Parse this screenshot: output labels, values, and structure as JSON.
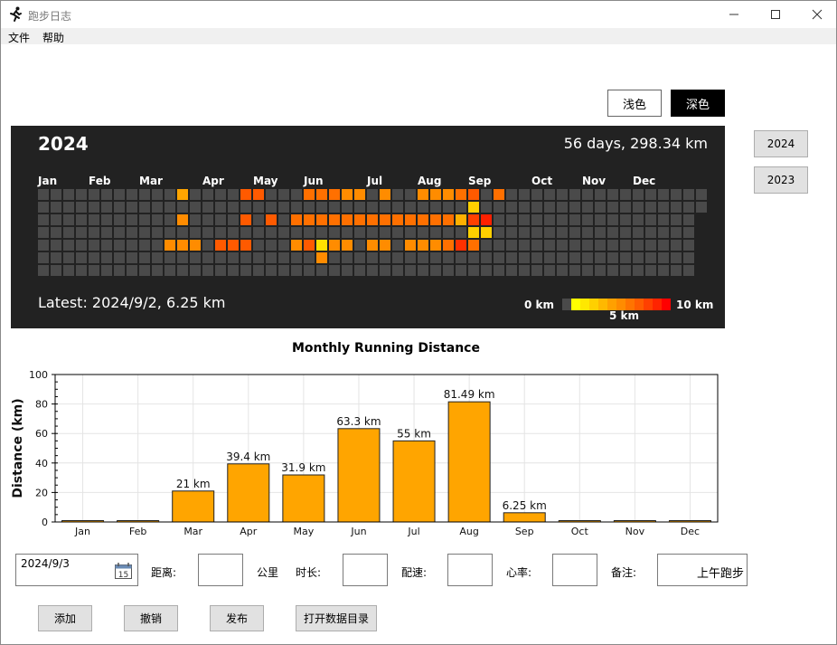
{
  "window": {
    "title": "跑步日志"
  },
  "menu": {
    "file": "文件",
    "help": "帮助"
  },
  "theme": {
    "light": "浅色",
    "dark": "深色"
  },
  "year_buttons": [
    "2024",
    "2023"
  ],
  "heatmap": {
    "year": "2024",
    "summary": "56 days, 298.34 km",
    "latest": "Latest:  2024/9/2, 6.25 km",
    "months": [
      "Jan",
      "Feb",
      "Mar",
      "Apr",
      "May",
      "Jun",
      "Jul",
      "Aug",
      "Sep",
      "Oct",
      "Nov",
      "Dec"
    ],
    "empty_color": "#4a4a4a",
    "legend": {
      "min_label": "0 km",
      "mid_label": "5 km",
      "max_label": "10 km",
      "colors": [
        "#4a4a4a",
        "#ffff00",
        "#ffe800",
        "#ffd000",
        "#ffb800",
        "#ffa000",
        "#ff8c00",
        "#ff7400",
        "#ff5c00",
        "#ff4000",
        "#ff2400",
        "#ff0000"
      ]
    },
    "active_cells": [
      {
        "w": 11,
        "d": 0,
        "color": "#ffa500"
      },
      {
        "w": 11,
        "d": 2,
        "color": "#ff8c00"
      },
      {
        "w": 10,
        "d": 4,
        "color": "#ff8c00"
      },
      {
        "w": 11,
        "d": 4,
        "color": "#ff8c00"
      },
      {
        "w": 12,
        "d": 4,
        "color": "#ff8c00"
      },
      {
        "w": 16,
        "d": 0,
        "color": "#ff5a00"
      },
      {
        "w": 17,
        "d": 0,
        "color": "#ff5a00"
      },
      {
        "w": 16,
        "d": 2,
        "color": "#ff5a00"
      },
      {
        "w": 18,
        "d": 2,
        "color": "#ff5a00"
      },
      {
        "w": 14,
        "d": 4,
        "color": "#ff5a00"
      },
      {
        "w": 15,
        "d": 4,
        "color": "#ff5a00"
      },
      {
        "w": 16,
        "d": 4,
        "color": "#ff5a00"
      },
      {
        "w": 20,
        "d": 2,
        "color": "#ff7000"
      },
      {
        "w": 20,
        "d": 4,
        "color": "#ff8c00"
      },
      {
        "w": 21,
        "d": 0,
        "color": "#ff7000"
      },
      {
        "w": 22,
        "d": 0,
        "color": "#ff7000"
      },
      {
        "w": 23,
        "d": 0,
        "color": "#ff7000"
      },
      {
        "w": 24,
        "d": 0,
        "color": "#ff8c00"
      },
      {
        "w": 25,
        "d": 0,
        "color": "#ff8c00"
      },
      {
        "w": 21,
        "d": 2,
        "color": "#ff7000"
      },
      {
        "w": 22,
        "d": 2,
        "color": "#ff7000"
      },
      {
        "w": 23,
        "d": 2,
        "color": "#ff7000"
      },
      {
        "w": 24,
        "d": 2,
        "color": "#ff7000"
      },
      {
        "w": 25,
        "d": 2,
        "color": "#ff7000"
      },
      {
        "w": 21,
        "d": 4,
        "color": "#ff5a00"
      },
      {
        "w": 22,
        "d": 4,
        "color": "#ffe000"
      },
      {
        "w": 23,
        "d": 4,
        "color": "#ff8c00"
      },
      {
        "w": 24,
        "d": 4,
        "color": "#ff8c00"
      },
      {
        "w": 22,
        "d": 5,
        "color": "#ff8c00"
      },
      {
        "w": 27,
        "d": 0,
        "color": "#ff8c00"
      },
      {
        "w": 26,
        "d": 2,
        "color": "#ff7000"
      },
      {
        "w": 27,
        "d": 2,
        "color": "#ff7000"
      },
      {
        "w": 28,
        "d": 2,
        "color": "#ff7000"
      },
      {
        "w": 29,
        "d": 2,
        "color": "#ff7000"
      },
      {
        "w": 30,
        "d": 2,
        "color": "#ff7000"
      },
      {
        "w": 26,
        "d": 4,
        "color": "#ff8c00"
      },
      {
        "w": 27,
        "d": 4,
        "color": "#ff8c00"
      },
      {
        "w": 29,
        "d": 4,
        "color": "#ff8c00"
      },
      {
        "w": 30,
        "d": 4,
        "color": "#ff8c00"
      },
      {
        "w": 30,
        "d": 0,
        "color": "#ff8c00"
      },
      {
        "w": 31,
        "d": 0,
        "color": "#ff8c00"
      },
      {
        "w": 32,
        "d": 0,
        "color": "#ff8c00"
      },
      {
        "w": 33,
        "d": 0,
        "color": "#ff7000"
      },
      {
        "w": 34,
        "d": 0,
        "color": "#ff5a00"
      },
      {
        "w": 31,
        "d": 2,
        "color": "#ff7000"
      },
      {
        "w": 32,
        "d": 2,
        "color": "#ff7000"
      },
      {
        "w": 33,
        "d": 2,
        "color": "#ffb000"
      },
      {
        "w": 34,
        "d": 2,
        "color": "#ff4000"
      },
      {
        "w": 31,
        "d": 4,
        "color": "#ff8c00"
      },
      {
        "w": 32,
        "d": 4,
        "color": "#ff7000"
      },
      {
        "w": 33,
        "d": 4,
        "color": "#ff3000"
      },
      {
        "w": 34,
        "d": 4,
        "color": "#ff7000"
      },
      {
        "w": 34,
        "d": 1,
        "color": "#ffd000"
      },
      {
        "w": 34,
        "d": 3,
        "color": "#ffd000"
      },
      {
        "w": 35,
        "d": 2,
        "color": "#ff2000"
      },
      {
        "w": 35,
        "d": 3,
        "color": "#ffd000"
      },
      {
        "w": 36,
        "d": 0,
        "color": "#ff7000"
      }
    ]
  },
  "chart_data": {
    "type": "bar",
    "title": "Monthly Running Distance",
    "xlabel": "",
    "ylabel": "Distance (km)",
    "categories": [
      "Jan",
      "Feb",
      "Mar",
      "Apr",
      "May",
      "Jun",
      "Jul",
      "Aug",
      "Sep",
      "Oct",
      "Nov",
      "Dec"
    ],
    "values": [
      0,
      0,
      21,
      39.4,
      31.9,
      63.3,
      55,
      81.49,
      6.25,
      0,
      0,
      0
    ],
    "data_labels": [
      "",
      "",
      "21 km",
      "39.4 km",
      "31.9 km",
      "63.3 km",
      "55 km",
      "81.49 km",
      "6.25 km",
      "",
      "",
      ""
    ],
    "yticks": [
      0,
      20,
      40,
      60,
      80,
      100
    ],
    "ylim": [
      0,
      100
    ],
    "grid": true,
    "bar_color": "#ffa500"
  },
  "form": {
    "date": "2024/9/3",
    "calendar_day": "15",
    "distance_label": "距离:",
    "distance_unit": "公里",
    "duration_label": "时长:",
    "pace_label": "配速:",
    "heart_rate_label": "心率:",
    "note_label": "备注:",
    "note_value": "上午跑步"
  },
  "actions": {
    "add": "添加",
    "undo": "撤销",
    "publish": "发布",
    "open_dir": "打开数据目录"
  }
}
